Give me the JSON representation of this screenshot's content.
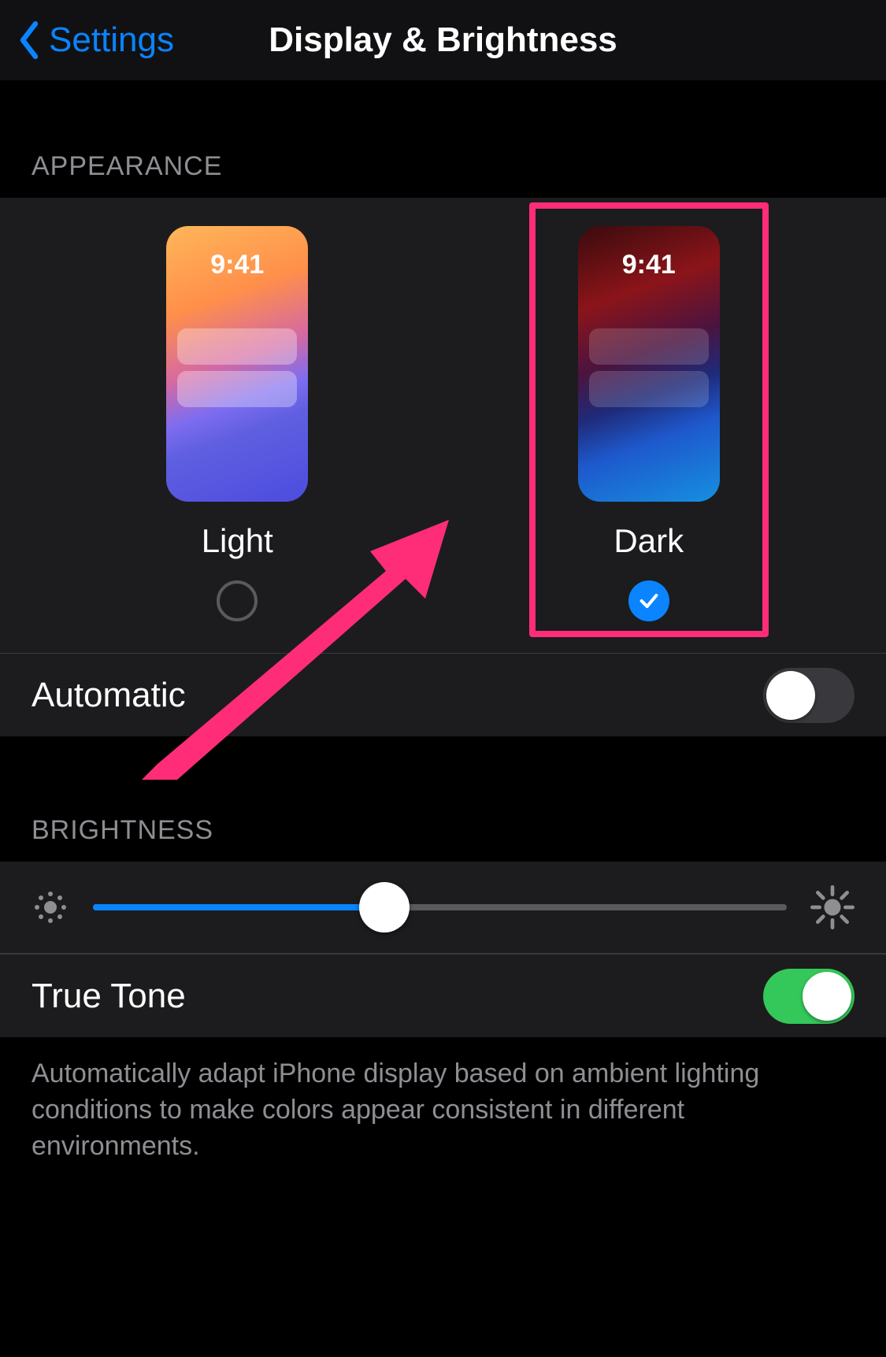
{
  "nav": {
    "back_label": "Settings",
    "title": "Display & Brightness"
  },
  "appearance": {
    "header": "APPEARANCE",
    "preview_time": "9:41",
    "light_label": "Light",
    "dark_label": "Dark",
    "selected": "dark",
    "automatic_label": "Automatic",
    "automatic_on": false
  },
  "brightness": {
    "header": "BRIGHTNESS",
    "value_pct": 42,
    "true_tone_label": "True Tone",
    "true_tone_on": true,
    "footer": "Automatically adapt iPhone display based on ambient lighting conditions to make colors appear consistent in different environments."
  },
  "colors": {
    "accent_blue": "#0a84ff",
    "accent_green": "#34c759",
    "highlight_pink": "#ff2d78"
  },
  "annotation": {
    "highlight_target": "dark-option",
    "shape": "arrow"
  }
}
